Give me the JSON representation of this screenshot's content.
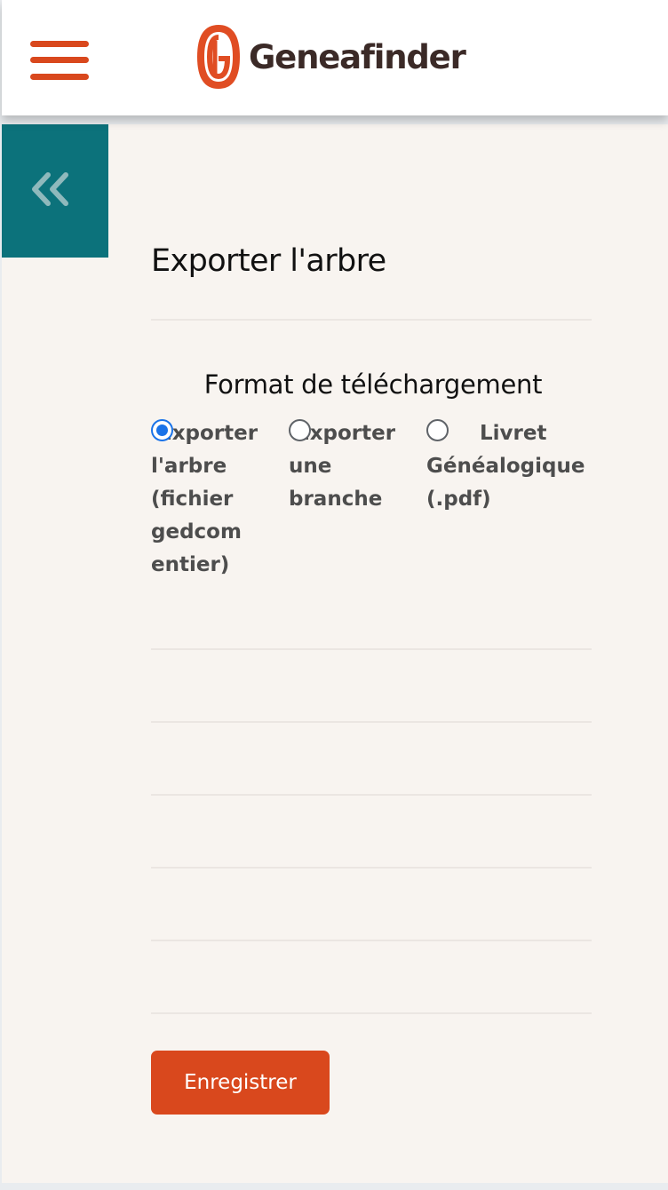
{
  "header": {
    "menu_icon": "hamburger-icon",
    "brand_name": "Geneafinder",
    "brand_color": "#d9481d"
  },
  "sidebar_toggle": {
    "icon": "double-chevron-left-icon",
    "color": "#0c727b"
  },
  "main": {
    "title": "Exporter l'arbre",
    "format_label": "Format de téléchargement",
    "options": [
      {
        "label": "Exporter l'arbre (fichier gedcom entier)",
        "selected": true
      },
      {
        "label": "Exporter une branche",
        "selected": false
      },
      {
        "label": "Livret Généalogique (.pdf)",
        "selected": false
      }
    ],
    "save_label": "Enregistrer"
  }
}
